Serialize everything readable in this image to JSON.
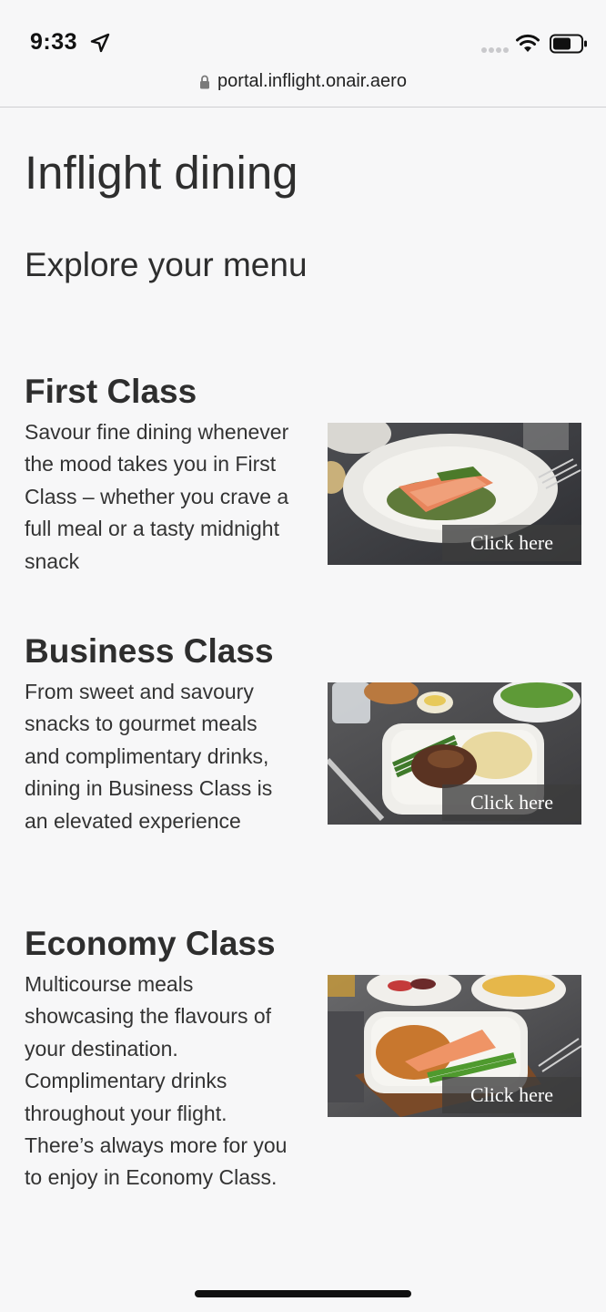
{
  "status_bar": {
    "time": "9:33",
    "url": "portal.inflight.onair.aero"
  },
  "page": {
    "title": "Inflight dining",
    "subtitle": "Explore your menu"
  },
  "sections": [
    {
      "heading": "First Class",
      "description": "Savour fine dining whenever the mood takes you in First Class – whether you crave a full meal or a tasty midnight snack",
      "cta": "Click here",
      "image_icon": "salmon-dish-image"
    },
    {
      "heading": "Business Class",
      "description": "From sweet and savoury snacks to gourmet meals and complimentary drinks, dining in Business Class is an elevated experience",
      "cta": "Click here",
      "image_icon": "steak-dish-image"
    },
    {
      "heading": "Economy Class",
      "description": "Multicourse meals showcasing the flavours of your destination. Complimentary drinks throughout your flight. There’s always more for you to enjoy in Economy Class.",
      "cta": "Click here",
      "image_icon": "economy-meal-image"
    }
  ],
  "colors": {
    "background": "#f7f7f8",
    "text": "#2e2e2e",
    "overlay": "#3c3c3c"
  }
}
